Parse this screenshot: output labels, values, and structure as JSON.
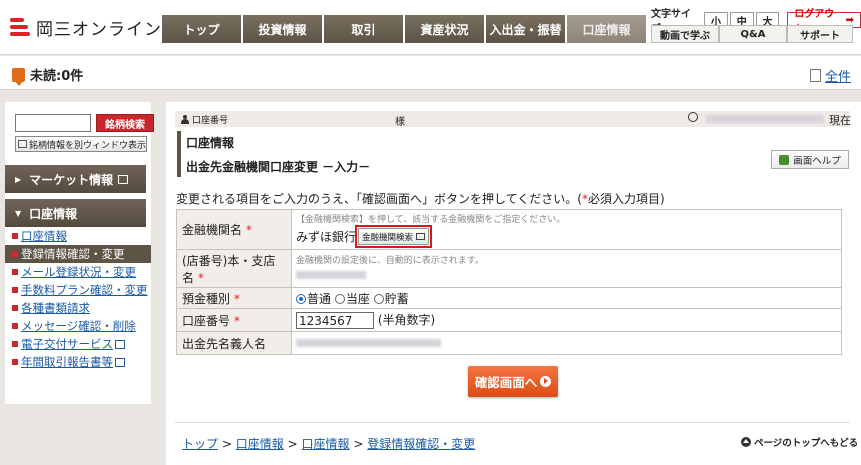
{
  "header": {
    "logo_text": "岡三オンライン",
    "nav_tabs": [
      "トップ",
      "投資情報",
      "取引",
      "資産状況",
      "入出金・振替",
      "口座情報"
    ],
    "font_size_label": "文字サイズ",
    "font_sizes": [
      "小",
      "中",
      "大"
    ],
    "logout_label": "ログアウト",
    "util_links": [
      "動画で学ぶ",
      "Q&A",
      "サポート"
    ]
  },
  "notice": {
    "unread_label": "未読:0件",
    "all_link": "全件"
  },
  "sidebar": {
    "search_button": "銘柄検索",
    "new_window_button": "銘柄情報を別ウィンドウ表示",
    "market_header": "マーケット情報",
    "account_header": "口座情報",
    "items": [
      {
        "label": "口座情報"
      },
      {
        "label": "登録情報確認・変更"
      },
      {
        "label": "メール登録状況・変更"
      },
      {
        "label": "手数料プラン確認・変更"
      },
      {
        "label": "各種書類請求"
      },
      {
        "label": "メッセージ確認・削除"
      },
      {
        "label": "電子交付サービス"
      },
      {
        "label": "年間取引報告書等"
      }
    ]
  },
  "main": {
    "account_number_label": "口座番号",
    "sama": "様",
    "genzai": "現在",
    "section_title": "口座情報",
    "page_title": "出金先金融機関口座変更 －入力－",
    "help_button": "画面ヘルプ",
    "instruction_prefix": "変更される項目をご入力のうえ、「確認画面へ」ボタンを押してください。(",
    "required_mark": "*",
    "instruction_suffix": "必須入力項目)",
    "form": {
      "bank_label": "金融機関名",
      "bank_hint": "【金融機関検索】を押して、該当する金融機関をご指定ください。",
      "bank_value": "みずほ銀行",
      "bank_search_button": "金融機関検索",
      "branch_label_1": "(店番号)本・支店",
      "branch_label_2": "名",
      "branch_hint": "金融機関の設定後に、自動的に表示されます。",
      "deposit_label": "預金種別",
      "deposit_options": [
        "普通",
        "当座",
        "貯蓄"
      ],
      "deposit_selected": "普通",
      "account_label": "口座番号",
      "account_value": "1234567",
      "account_note": "(半角数字)",
      "holder_label": "出金先名義人名"
    },
    "confirm_button": "確認画面へ",
    "breadcrumb": [
      "トップ",
      "口座情報",
      "口座情報",
      "登録情報確認・変更"
    ],
    "breadcrumb_sep": ">",
    "page_top": "ページのトップへもどる"
  },
  "colors": {
    "brand_red": "#d8242a",
    "nav_brown": "#5e5446",
    "confirm_orange": "#e85a22",
    "link_blue": "#1a5aa6"
  }
}
